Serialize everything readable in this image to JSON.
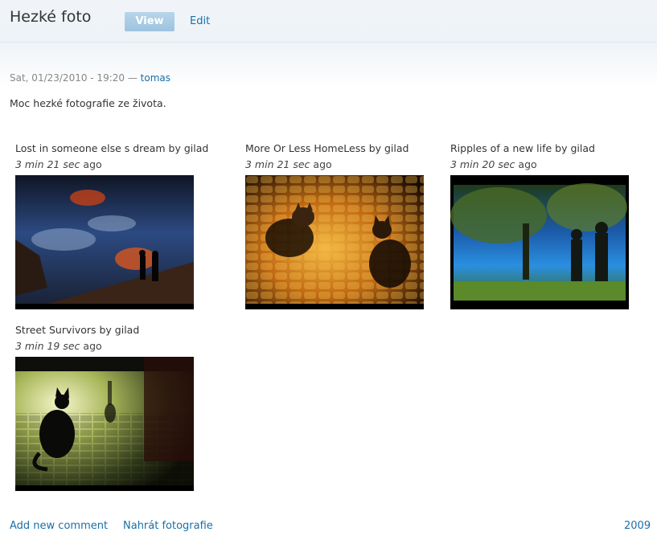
{
  "header": {
    "title": "Hezké foto",
    "tabs": [
      {
        "label": "View",
        "active": true
      },
      {
        "label": "Edit",
        "active": false
      }
    ]
  },
  "node": {
    "date": "Sat, 01/23/2010 - 19:20",
    "separator": "—",
    "author": "tomas",
    "body": "Moc hezké fotografie ze života."
  },
  "gallery": {
    "items": [
      {
        "title": "Lost in someone else s dream by gilad",
        "age": "3 min 21 sec",
        "age_suffix": "ago"
      },
      {
        "title": "More Or Less HomeLess by gilad",
        "age": "3 min 21 sec",
        "age_suffix": "ago"
      },
      {
        "title": "Ripples of a new life by gilad",
        "age": "3 min 20 sec",
        "age_suffix": "ago"
      },
      {
        "title": "Street Survivors by gilad",
        "age": "3 min 19 sec",
        "age_suffix": "ago"
      }
    ]
  },
  "footer": {
    "add_comment": "Add new comment",
    "upload": "Nahrát fotografie",
    "term": "2009"
  },
  "colors": {
    "link": "#1a6fa8",
    "active_tab": "#9dc3e0"
  }
}
